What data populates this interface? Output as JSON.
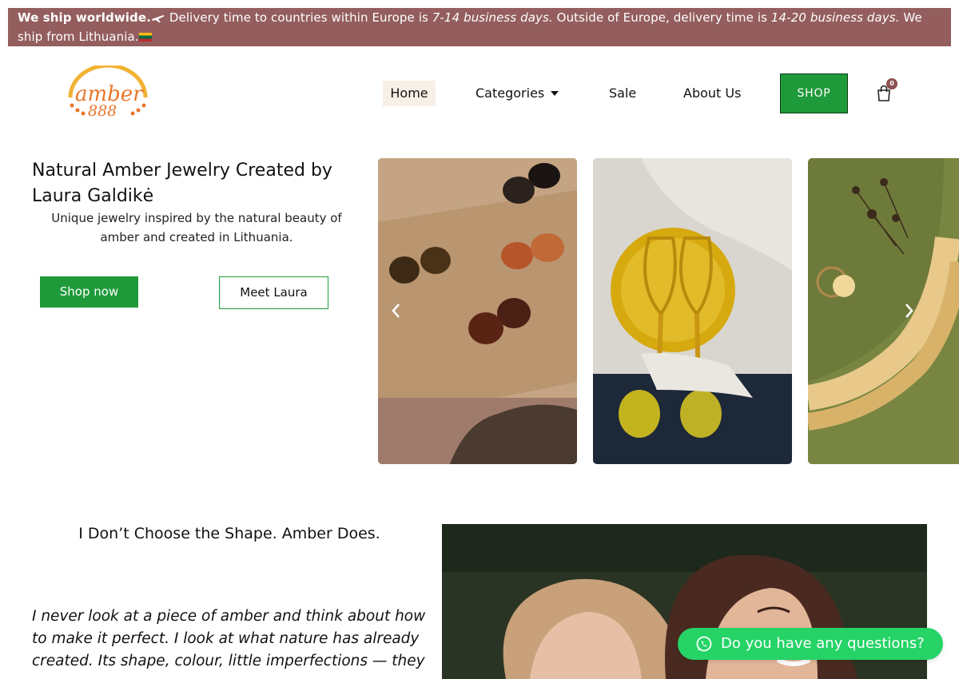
{
  "announcement": {
    "bold": "We ship worldwide.",
    "part1": " Delivery time to countries within Europe is ",
    "eu_time": "7-14 business days.",
    "part2": " Outside of Europe, delivery time is ",
    "world_time": "14-20 business days.",
    "part3": " We ship from Lithuania."
  },
  "logo": {
    "text": "amber",
    "number": "888",
    "icon": "amber-888-logo"
  },
  "nav": {
    "items": [
      {
        "label": "Home",
        "active": true
      },
      {
        "label": "Categories",
        "icon": "chevron-down-icon"
      },
      {
        "label": "Sale"
      },
      {
        "label": "About Us"
      }
    ],
    "shop_label": "SHOP",
    "cart_count": "0",
    "cart_icon": "cart-icon"
  },
  "hero": {
    "title": "Natural Amber Jewelry Created by Laura Galdikė",
    "subtitle": "Unique jewelry inspired by the natural beauty of amber and created in Lithuania.",
    "primary_button": "Shop now",
    "secondary_button": "Meet Laura"
  },
  "carousel": {
    "prev_icon": "chevron-left-icon",
    "next_icon": "chevron-right-icon"
  },
  "story": {
    "title": "I Don’t Choose the Shape. Amber Does.",
    "quote": "I never look at a piece of amber and think about how to make it perfect. I look at what nature has already created. Its shape, colour, little imperfections — they"
  },
  "chat": {
    "label": "Do you have any questions?",
    "icon": "whatsapp-icon"
  },
  "colors": {
    "banner": "#945e5e",
    "accent_green": "#1f9a3a",
    "whatsapp": "#25d366",
    "home_bg": "#f8efe7"
  }
}
